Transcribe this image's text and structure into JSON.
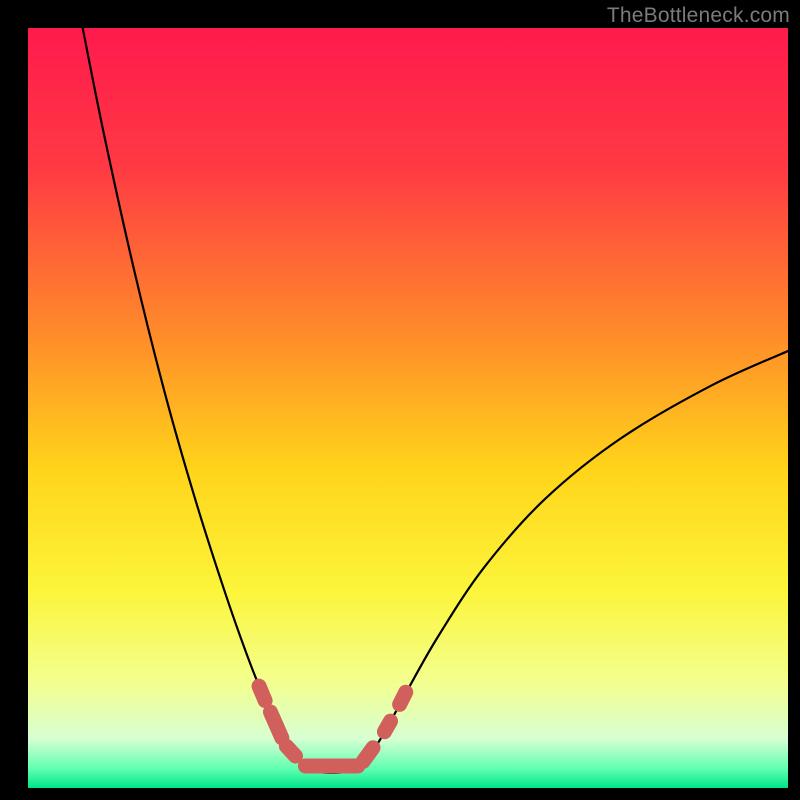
{
  "watermark": "TheBottleneck.com",
  "frame": {
    "outer_color": "#000000",
    "inner_left": 28,
    "inner_top": 28,
    "inner_right": 788,
    "inner_bottom": 788
  },
  "gradient": {
    "stops": [
      {
        "offset": 0.0,
        "color": "#ff1a4d"
      },
      {
        "offset": 0.18,
        "color": "#ff3944"
      },
      {
        "offset": 0.4,
        "color": "#ff8a2a"
      },
      {
        "offset": 0.58,
        "color": "#ffd41a"
      },
      {
        "offset": 0.74,
        "color": "#fcf53a"
      },
      {
        "offset": 0.86,
        "color": "#f3ff8e"
      },
      {
        "offset": 0.935,
        "color": "#d8ffd2"
      },
      {
        "offset": 0.975,
        "color": "#5fffb0"
      },
      {
        "offset": 1.0,
        "color": "#00e589"
      }
    ]
  },
  "curve": {
    "stroke": "#000000",
    "stroke_width": 2.2
  },
  "marker": {
    "stroke": "#d1605d",
    "stroke_width": 15,
    "linecap": "round"
  },
  "chart_data": {
    "type": "line",
    "title": "",
    "xlabel": "",
    "ylabel": "",
    "x_range": [
      0,
      100
    ],
    "y_range": [
      0,
      100
    ],
    "curve_points": [
      {
        "x": 7.0,
        "y": 101.0
      },
      {
        "x": 10.0,
        "y": 86.0
      },
      {
        "x": 14.0,
        "y": 68.0
      },
      {
        "x": 18.0,
        "y": 52.0
      },
      {
        "x": 22.0,
        "y": 38.0
      },
      {
        "x": 26.0,
        "y": 25.5
      },
      {
        "x": 29.0,
        "y": 17.0
      },
      {
        "x": 31.0,
        "y": 12.0
      },
      {
        "x": 33.0,
        "y": 7.5
      },
      {
        "x": 35.0,
        "y": 4.5
      },
      {
        "x": 37.5,
        "y": 2.4
      },
      {
        "x": 40.0,
        "y": 2.0
      },
      {
        "x": 42.5,
        "y": 2.4
      },
      {
        "x": 45.0,
        "y": 4.5
      },
      {
        "x": 47.0,
        "y": 7.5
      },
      {
        "x": 50.0,
        "y": 13.0
      },
      {
        "x": 54.0,
        "y": 20.0
      },
      {
        "x": 60.0,
        "y": 29.0
      },
      {
        "x": 68.0,
        "y": 38.0
      },
      {
        "x": 78.0,
        "y": 46.0
      },
      {
        "x": 90.0,
        "y": 53.0
      },
      {
        "x": 100.0,
        "y": 57.5
      }
    ],
    "marker_segments": [
      {
        "from": {
          "x": 30.4,
          "y": 13.4
        },
        "to": {
          "x": 31.2,
          "y": 11.5
        }
      },
      {
        "from": {
          "x": 31.9,
          "y": 10.0
        },
        "to": {
          "x": 33.4,
          "y": 6.6
        }
      },
      {
        "from": {
          "x": 34.0,
          "y": 5.5
        },
        "to": {
          "x": 35.2,
          "y": 4.2
        }
      },
      {
        "from": {
          "x": 36.5,
          "y": 2.9
        },
        "to": {
          "x": 43.4,
          "y": 2.9
        }
      },
      {
        "from": {
          "x": 44.1,
          "y": 3.5
        },
        "to": {
          "x": 45.4,
          "y": 5.3
        }
      },
      {
        "from": {
          "x": 46.9,
          "y": 7.4
        },
        "to": {
          "x": 47.7,
          "y": 8.8
        }
      },
      {
        "from": {
          "x": 48.9,
          "y": 11.0
        },
        "to": {
          "x": 49.7,
          "y": 12.6
        }
      }
    ],
    "annotations": []
  }
}
